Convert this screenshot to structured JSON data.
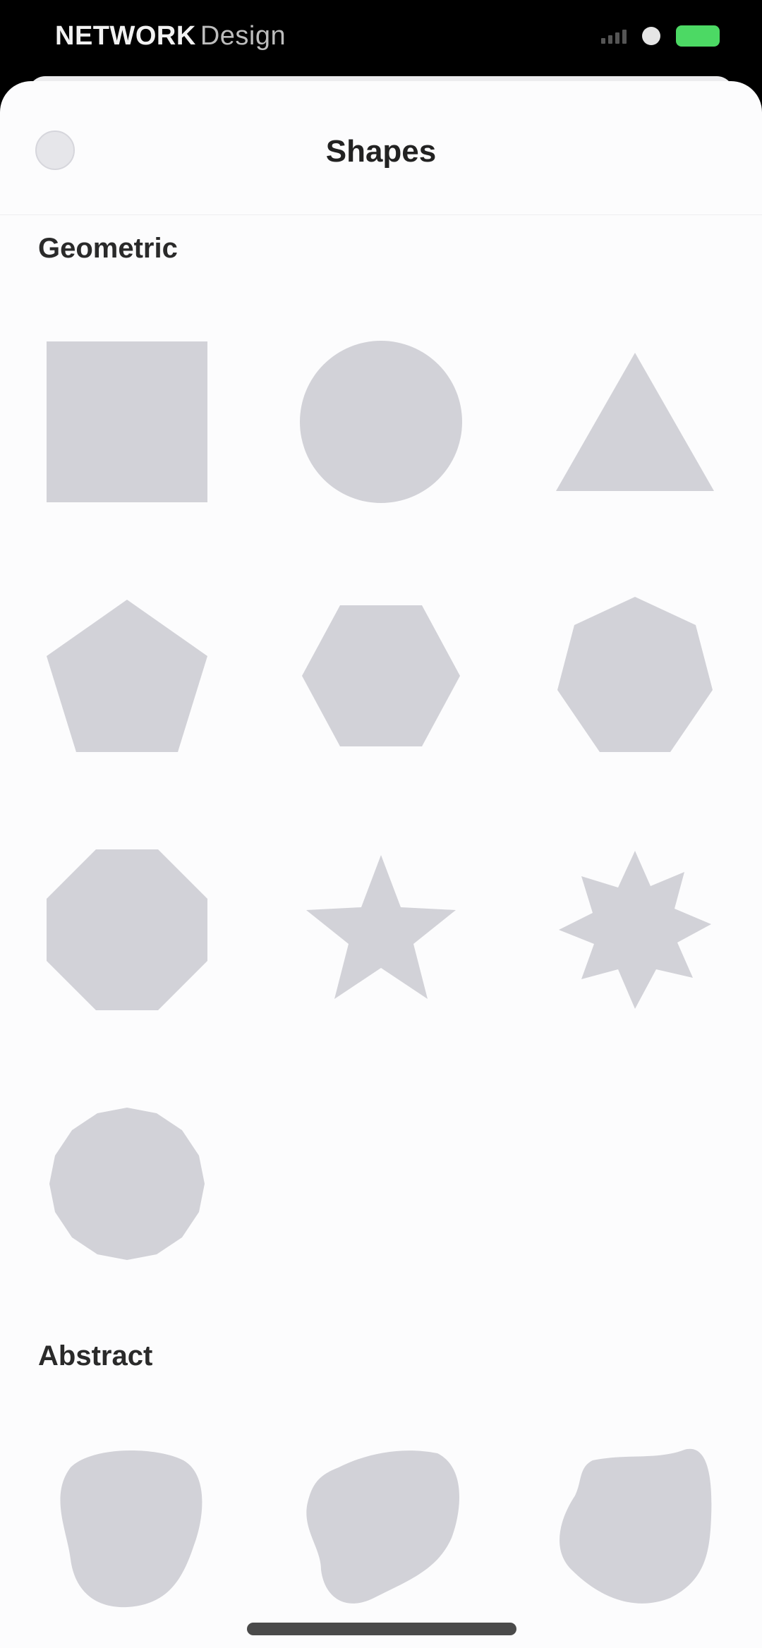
{
  "status_bar": {
    "carrier": "NETWORK",
    "carrier_sub": "Design"
  },
  "nav": {
    "title": "Shapes"
  },
  "sections": [
    {
      "title": "Geometric",
      "items": [
        {
          "name": "square"
        },
        {
          "name": "circle"
        },
        {
          "name": "triangle"
        },
        {
          "name": "pentagon"
        },
        {
          "name": "hexagon"
        },
        {
          "name": "heptagon"
        },
        {
          "name": "octagon"
        },
        {
          "name": "star"
        },
        {
          "name": "starburst"
        },
        {
          "name": "polygon-many-sides"
        }
      ]
    },
    {
      "title": "Abstract",
      "items": [
        {
          "name": "blob-1"
        },
        {
          "name": "blob-2"
        },
        {
          "name": "blob-3"
        }
      ]
    }
  ],
  "colors": {
    "shape_fill": "#d2d2d8",
    "background": "#fcfcfd",
    "battery": "#4cd964"
  }
}
